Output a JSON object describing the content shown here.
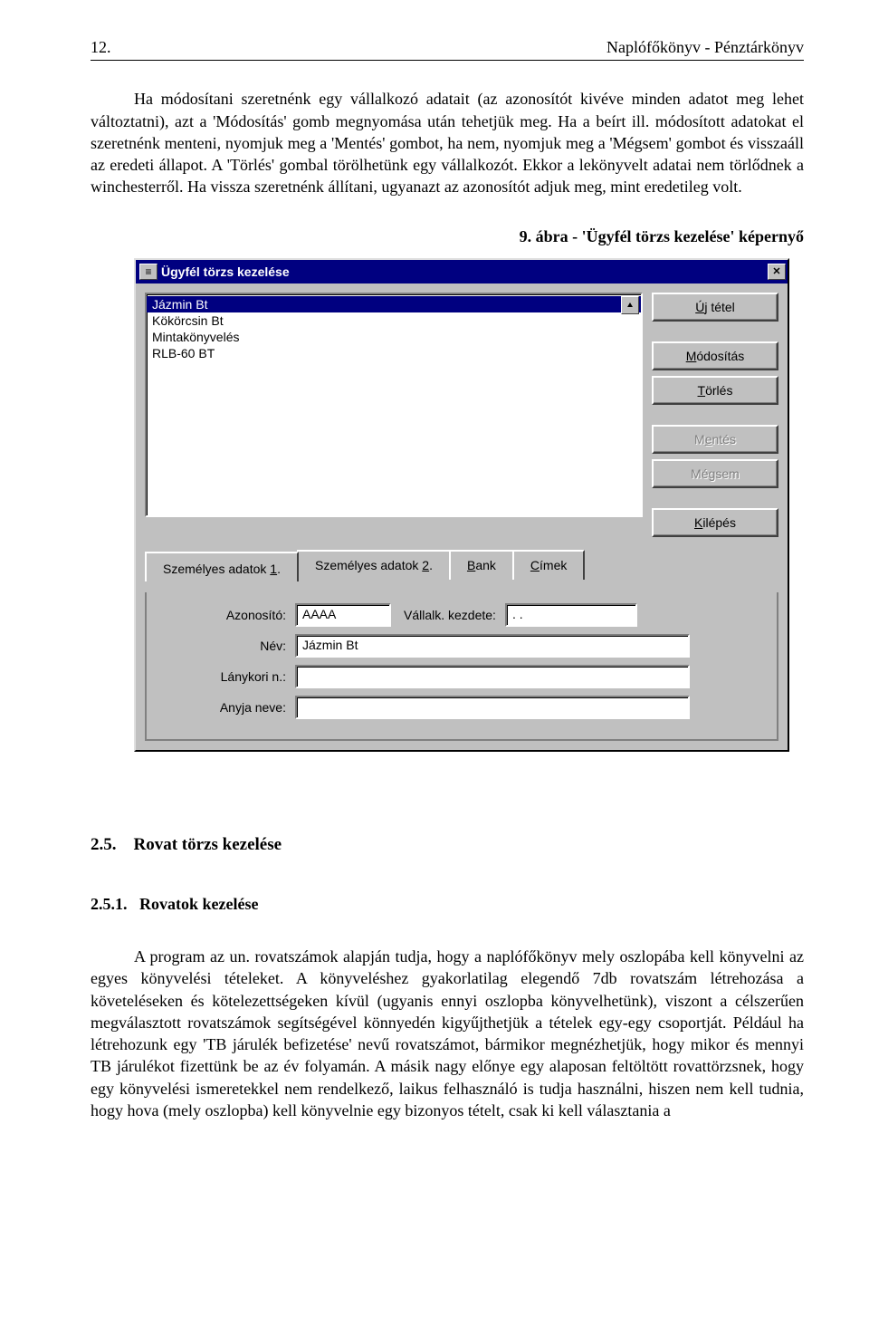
{
  "header": {
    "page_number": "12.",
    "doc_title": "Naplófőkönyv - Pénztárkönyv"
  },
  "para1": "Ha módosítani szeretnénk egy vállalkozó adatait (az azonosítót kivéve minden adatot meg lehet változtatni), azt a 'Módosítás' gomb megnyomása után tehetjük meg. Ha a beírt ill. módosított adatokat el szeretnénk menteni, nyomjuk meg a 'Mentés' gombot, ha nem, nyomjuk meg a 'Mégsem' gombot és visszaáll az eredeti állapot. A 'Törlés' gombal törölhetünk egy vállalkozót. Ekkor a lekönyvelt adatai nem törlődnek a winchesterről. Ha vissza szeretnénk állítani, ugyanazt az azonosítót adjuk meg, mint eredetileg volt.",
  "figure_caption": "9. ábra - 'Ügyfél törzs kezelése' képernyő",
  "dialog": {
    "title": "Ügyfél törzs kezelése",
    "list_items": [
      "Jázmin Bt",
      "Kökörcsin Bt",
      "Mintakönyvelés",
      "RLB-60 BT"
    ],
    "buttons": {
      "new": "Új tétel",
      "modify": "Módosítás",
      "delete": "Törlés",
      "save": "Mentés",
      "cancel": "Mégsem",
      "exit": "Kilépés"
    },
    "tabs": {
      "pers1": "Személyes adatok 1.",
      "pers2": "Személyes adatok 2.",
      "bank": "Bank",
      "addr": "Címek"
    },
    "fields": {
      "id_label": "Azonosító:",
      "id_value": "AAAA",
      "start_label": "Vállalk. kezdete:",
      "start_value": ".   .",
      "name_label": "Név:",
      "name_value": "Jázmin Bt",
      "maiden_label": "Lánykori n.:",
      "maiden_value": "",
      "mother_label": "Anyja neve:",
      "mother_value": ""
    }
  },
  "sec25_num": "2.5.",
  "sec25_title": "Rovat törzs kezelése",
  "sec251_num": "2.5.1.",
  "sec251_title": "Rovatok kezelése",
  "para2": "A program az un. rovatszámok alapján tudja, hogy a naplófőkönyv mely oszlopába kell könyvelni az egyes könyvelési tételeket. A könyveléshez gyakorlatilag elegendő 7db rovatszám létrehozása a követeléseken és kötelezettségeken kívül (ugyanis ennyi oszlopba könyvelhetünk), viszont a célszerűen megválasztott rovatszámok segítségével könnyedén kigyűjthetjük a tételek egy-egy csoportját. Például ha létrehozunk egy 'TB járulék befizetése' nevű rovatszámot, bármikor megnézhetjük, hogy mikor és mennyi TB járulékot fizettünk be az év folyamán. A másik nagy előnye egy alaposan feltöltött rovattörzsnek, hogy egy könyvelési ismeretekkel nem rendelkező, laikus felhasználó is tudja használni, hiszen nem kell tudnia, hogy hova (mely oszlopba) kell könyvelnie egy bizonyos tételt, csak ki kell választania a"
}
